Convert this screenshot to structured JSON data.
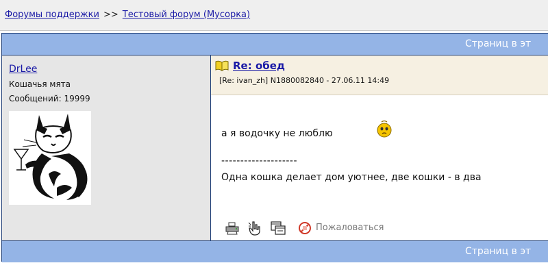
{
  "breadcrumb": {
    "forums_link": "Форумы поддержки",
    "separator": ">>",
    "forum_link": "Тестовый форум (Мусорка)"
  },
  "pagination": {
    "top_text": "Страниц в эт",
    "bottom_text": "Страниц в эт"
  },
  "user": {
    "name": "DrLee",
    "title": "Кошачья мята",
    "posts": "Сообщений: 19999"
  },
  "post": {
    "subject": "Re: обед",
    "meta": "[Re: ivan_zh]  N1880082840 - 27.06.11 14:49",
    "text": "а я водочку не люблю",
    "divider": "--------------------",
    "signature": "Одна кошка делает дом уютнее, две кошки - в два"
  },
  "actions": {
    "report_label": "Пожаловаться"
  },
  "colors": {
    "pages_bar": "#94b4e6",
    "frame_border": "#1f3f77",
    "user_column_bg": "#e6e6e6",
    "post_header_bg": "#f6f0e2",
    "link": "#1a1aa6"
  },
  "icons": [
    "book-icon",
    "smiley-icon",
    "print-icon",
    "quote-icon",
    "move-icon",
    "report-icon"
  ]
}
